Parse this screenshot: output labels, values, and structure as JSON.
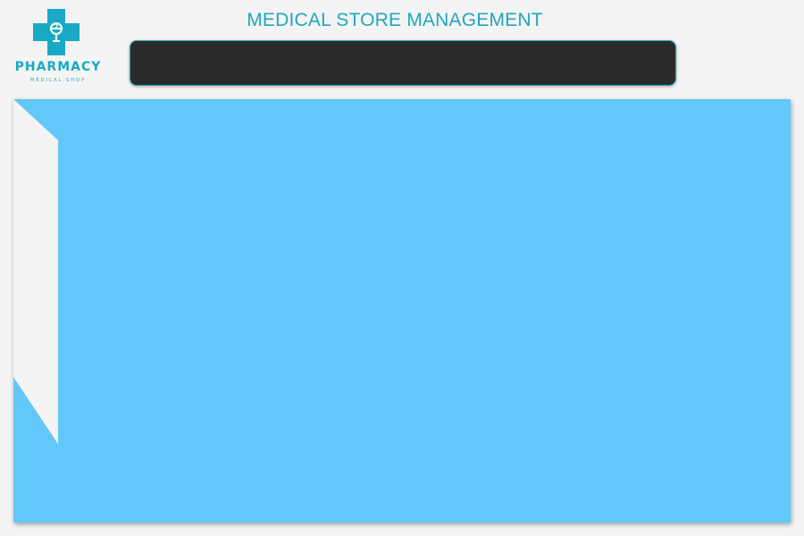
{
  "logo": {
    "icon": "pharmacy-cross-icon",
    "name": "PHARMACY",
    "tagline": "MEDICAL SHOP",
    "color": "#19a9c4"
  },
  "header": {
    "title": "MEDICAL STORE MANAGEMENT",
    "title_color": "#22a6bd",
    "bar_color": "#2b2b2b",
    "bar_border_color": "#20a9c2"
  },
  "main": {
    "panel_color": "#62c8f9",
    "side_tab_color": "#f4f3f3"
  }
}
